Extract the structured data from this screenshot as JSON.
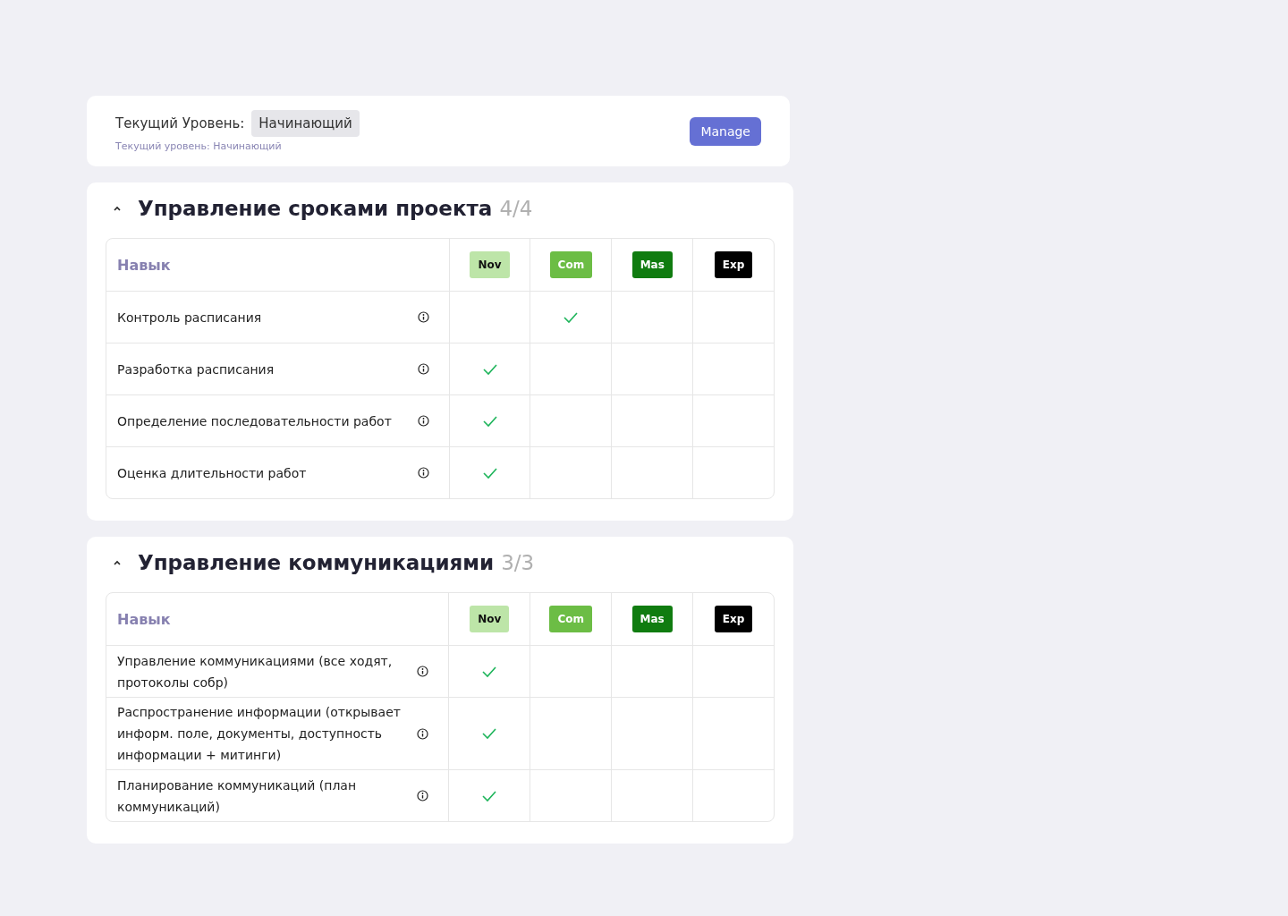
{
  "level_card": {
    "label": "Текущий Уровень:",
    "value": "Начинающий",
    "caption": "Текущий уровень: Начинающий",
    "button": "Manage"
  },
  "sections": [
    {
      "title": "Управление сроками проекта",
      "count": "4/4",
      "expanded": true,
      "skill_header": "Навык",
      "levels": [
        {
          "label": "Nov",
          "color": "#bde5a8"
        },
        {
          "label": "Com",
          "color": "#6cbd45"
        },
        {
          "label": "Mas",
          "color": "#107c10"
        },
        {
          "label": "Exp",
          "color": "#000000"
        }
      ],
      "rows": [
        {
          "skill": "Контроль расписания",
          "checks": [
            false,
            true,
            false,
            false
          ]
        },
        {
          "skill": "Разработка расписания",
          "checks": [
            true,
            false,
            false,
            false
          ]
        },
        {
          "skill": "Определение последовательности работ",
          "checks": [
            true,
            false,
            false,
            false
          ]
        },
        {
          "skill": "Оценка длительности работ",
          "checks": [
            true,
            false,
            false,
            false
          ]
        }
      ]
    },
    {
      "title": "Управление коммуникациями",
      "count": "3/3",
      "expanded": true,
      "skill_header": "Навык",
      "levels": [
        {
          "label": "Nov",
          "color": "#bde5a8"
        },
        {
          "label": "Com",
          "color": "#6cbd45"
        },
        {
          "label": "Mas",
          "color": "#107c10"
        },
        {
          "label": "Exp",
          "color": "#000000"
        }
      ],
      "rows": [
        {
          "skill": "Управление коммуникациями (все ходят, протоколы собр)",
          "checks": [
            true,
            false,
            false,
            false
          ]
        },
        {
          "skill": "Распространение информации (открывает информ. поле, документы, доступность информации + митинги)",
          "checks": [
            true,
            false,
            false,
            false
          ]
        },
        {
          "skill": "Планирование коммуникаций (план коммуникаций)",
          "checks": [
            true,
            false,
            false,
            false
          ]
        }
      ]
    }
  ]
}
